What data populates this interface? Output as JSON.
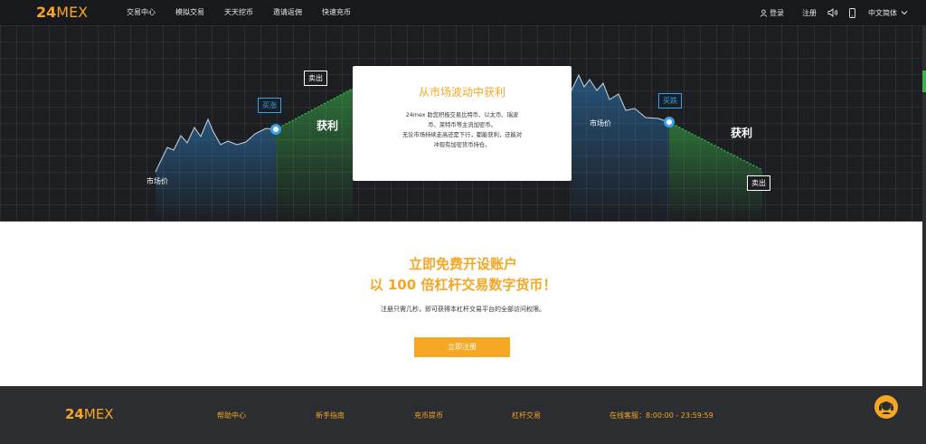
{
  "header": {
    "logo_num": "24",
    "logo_text": "MEX",
    "nav": [
      "交易中心",
      "模拟交易",
      "天天挖币",
      "邀请返佣",
      "快速充币"
    ],
    "login": "登录",
    "register": "注册",
    "language": "中文简体"
  },
  "hero": {
    "tag_buy_long": "买涨",
    "tag_sell_top": "卖出",
    "tag_buy_short": "买跌",
    "tag_sell_bottom": "卖出",
    "market_price_left": "市场价",
    "market_price_right": "市场价",
    "profit_left": "获利",
    "profit_right": "获利",
    "card": {
      "title": "从市场波动中获利",
      "line1": "24mex 助您积极交易比特币、以太币、瑞波",
      "line2": "币、莱特币等主流加密币。",
      "line3": "无论市场持续走高还是下行，都能获利，还能对",
      "line4": "冲现有加密货币持仓。"
    }
  },
  "signup": {
    "title1": "立即免费开设账户",
    "title2": "以 100 倍杠杆交易数字货币！",
    "desc": "注册只需几秒，即可获得本杠杆交易平台的全部访问权限。",
    "button": "立即注册"
  },
  "footer": {
    "logo_num": "24",
    "logo_text": "MEX",
    "links": [
      "帮助中心",
      "新手指南",
      "充币提币",
      "杠杆交易"
    ],
    "service": "在线客服：8:00:00 - 23:59:59"
  },
  "colors": {
    "accent": "#f5a623",
    "dark": "#1c1e22",
    "buy": "#3aa0e8",
    "profit_green": "#3ab34a"
  }
}
